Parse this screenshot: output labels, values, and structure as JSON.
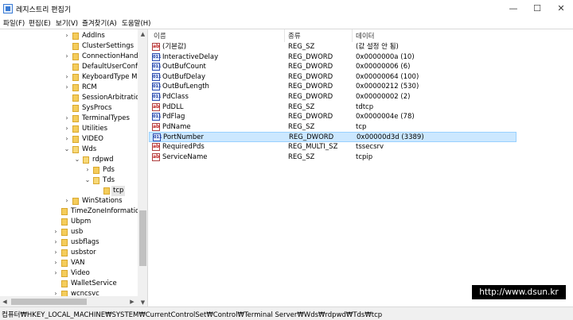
{
  "window": {
    "title": "레지스트리 편집기",
    "minimize_glyph": "—",
    "maximize_glyph": "☐",
    "close_glyph": "✕"
  },
  "menu": [
    "파일(F)",
    "편집(E)",
    "보기(V)",
    "즐겨찾기(A)",
    "도움말(H)"
  ],
  "tree": {
    "items": [
      {
        "label": "AddIns",
        "level": 0,
        "expander": "›",
        "selected": false
      },
      {
        "label": "ClusterSettings",
        "level": 0,
        "expander": "",
        "selected": false
      },
      {
        "label": "ConnectionHandle",
        "level": 0,
        "expander": "›",
        "selected": false
      },
      {
        "label": "DefaultUserConfig",
        "level": 0,
        "expander": "",
        "selected": false
      },
      {
        "label": "KeyboardType Ma",
        "level": 0,
        "expander": "›",
        "selected": false
      },
      {
        "label": "RCM",
        "level": 0,
        "expander": "›",
        "selected": false
      },
      {
        "label": "SessionArbitration",
        "level": 0,
        "expander": "",
        "selected": false
      },
      {
        "label": "SysProcs",
        "level": 0,
        "expander": "",
        "selected": false
      },
      {
        "label": "TerminalTypes",
        "level": 0,
        "expander": "›",
        "selected": false
      },
      {
        "label": "Utilities",
        "level": 0,
        "expander": "›",
        "selected": false
      },
      {
        "label": "VIDEO",
        "level": 0,
        "expander": "›",
        "selected": false
      },
      {
        "label": "Wds",
        "level": 0,
        "expander": "⌄",
        "selected": false
      },
      {
        "label": "rdpwd",
        "level": 1,
        "expander": "⌄",
        "selected": false
      },
      {
        "label": "Pds",
        "level": 2,
        "expander": "›",
        "selected": false
      },
      {
        "label": "Tds",
        "level": 2,
        "expander": "⌄",
        "selected": false
      },
      {
        "label": "tcp",
        "level": 3,
        "expander": "",
        "selected": true
      },
      {
        "label": "WinStations",
        "level": 0,
        "expander": "›",
        "selected": false
      },
      {
        "label": "TimeZoneInformation",
        "level": -1,
        "expander": "",
        "selected": false
      },
      {
        "label": "Ubpm",
        "level": -1,
        "expander": "",
        "selected": false
      },
      {
        "label": "usb",
        "level": -1,
        "expander": "›",
        "selected": false
      },
      {
        "label": "usbflags",
        "level": -1,
        "expander": "›",
        "selected": false
      },
      {
        "label": "usbstor",
        "level": -1,
        "expander": "›",
        "selected": false
      },
      {
        "label": "VAN",
        "level": -1,
        "expander": "›",
        "selected": false
      },
      {
        "label": "Video",
        "level": -1,
        "expander": "›",
        "selected": false
      },
      {
        "label": "WalletService",
        "level": -1,
        "expander": "",
        "selected": false
      },
      {
        "label": "wcncsvc",
        "level": -1,
        "expander": "›",
        "selected": false
      }
    ]
  },
  "list": {
    "headers": {
      "name": "이름",
      "type": "종류",
      "data": "데이터"
    },
    "rows": [
      {
        "icon": "sz",
        "name": "(기본값)",
        "type": "REG_SZ",
        "data": "(값 설정 안 됨)",
        "selected": false
      },
      {
        "icon": "bin",
        "name": "InteractiveDelay",
        "type": "REG_DWORD",
        "data": "0x0000000a (10)",
        "selected": false
      },
      {
        "icon": "bin",
        "name": "OutBufCount",
        "type": "REG_DWORD",
        "data": "0x00000006 (6)",
        "selected": false
      },
      {
        "icon": "bin",
        "name": "OutBufDelay",
        "type": "REG_DWORD",
        "data": "0x00000064 (100)",
        "selected": false
      },
      {
        "icon": "bin",
        "name": "OutBufLength",
        "type": "REG_DWORD",
        "data": "0x00000212 (530)",
        "selected": false
      },
      {
        "icon": "bin",
        "name": "PdClass",
        "type": "REG_DWORD",
        "data": "0x00000002 (2)",
        "selected": false
      },
      {
        "icon": "sz",
        "name": "PdDLL",
        "type": "REG_SZ",
        "data": "tdtcp",
        "selected": false
      },
      {
        "icon": "bin",
        "name": "PdFlag",
        "type": "REG_DWORD",
        "data": "0x0000004e (78)",
        "selected": false
      },
      {
        "icon": "sz",
        "name": "PdName",
        "type": "REG_SZ",
        "data": "tcp",
        "selected": false
      },
      {
        "icon": "bin",
        "name": "PortNumber",
        "type": "REG_DWORD",
        "data": "0x00000d3d (3389)",
        "selected": true
      },
      {
        "icon": "sz",
        "name": "RequiredPds",
        "type": "REG_MULTI_SZ",
        "data": "tssecsrv",
        "selected": false
      },
      {
        "icon": "sz",
        "name": "ServiceName",
        "type": "REG_SZ",
        "data": "tcpip",
        "selected": false
      }
    ]
  },
  "icons": {
    "sz": "ab",
    "bin": "011"
  },
  "status": {
    "path": "컴퓨터₩HKEY_LOCAL_MACHINE₩SYSTEM₩CurrentControlSet₩Control₩Terminal Server₩Wds₩rdpwd₩Tds₩tcp"
  },
  "watermark": "http://www.dsun.kr",
  "colors": {
    "selection": "#cce8ff",
    "selection_border": "#99d1ff",
    "folder": "#f4cc5b"
  }
}
